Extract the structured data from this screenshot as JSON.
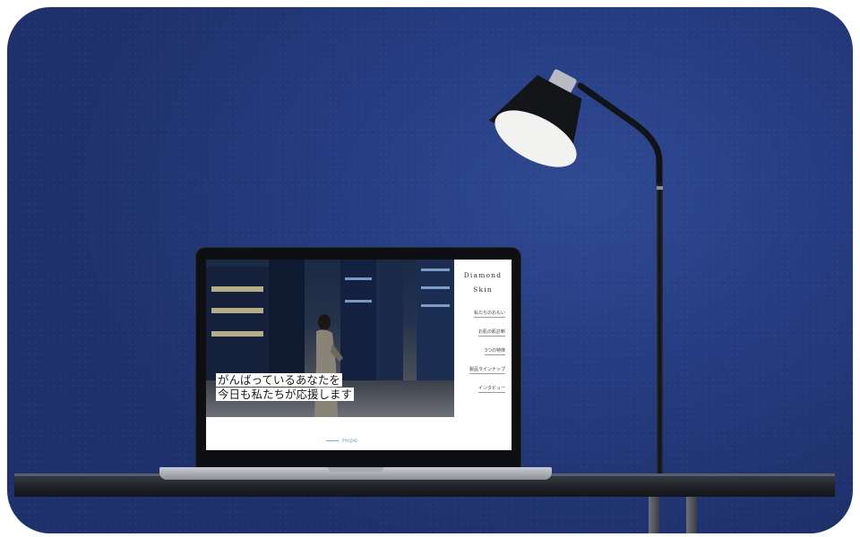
{
  "laptop_site": {
    "brand": [
      "Diamond",
      "Skin"
    ],
    "headline": [
      "がんばっているあなたを",
      "今日も私たちが応援します"
    ],
    "nav": [
      "私たちのおもい",
      "お肌の肌診断",
      "3つの特徴",
      "製品ラインナップ",
      "インタビュー"
    ],
    "section_label": "Hope"
  },
  "colors": {
    "wall": "#263d82",
    "accent_link": "#7aa6cf"
  }
}
